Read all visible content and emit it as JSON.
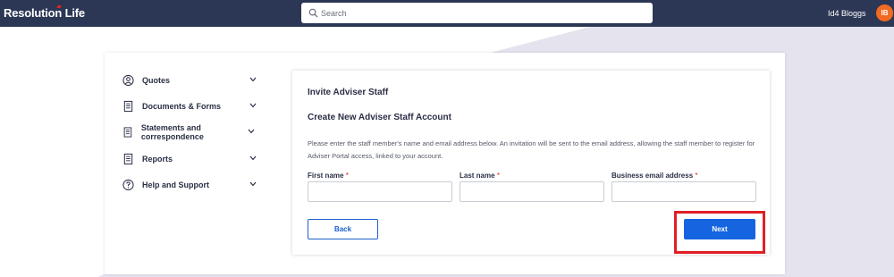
{
  "header": {
    "logo_text": "Resolution Life",
    "search_placeholder": "Search",
    "username": "Id4 Bloggs",
    "avatar_initials": "IB"
  },
  "sidebar": {
    "items": [
      {
        "label": "Quotes",
        "icon": "user-circle-icon"
      },
      {
        "label": "Documents & Forms",
        "icon": "document-icon"
      },
      {
        "label": "Statements and correspondence",
        "icon": "document-icon"
      },
      {
        "label": "Reports",
        "icon": "document-icon"
      },
      {
        "label": "Help and Support",
        "icon": "question-circle-icon"
      }
    ]
  },
  "main": {
    "title": "Invite Adviser Staff",
    "subtitle": "Create New Adviser Staff Account",
    "description": "Please enter the staff member's name and email address below. An invitation will be sent to the email address, allowing the staff member to register for Adviser Portal access, linked to your account.",
    "fields": [
      {
        "label": "First name",
        "required_mark": "*",
        "value": ""
      },
      {
        "label": "Last name",
        "required_mark": "*",
        "value": ""
      },
      {
        "label": "Business email address",
        "required_mark": "*",
        "value": ""
      }
    ],
    "back_label": "Back",
    "next_label": "Next"
  },
  "colors": {
    "header_bg": "#2c3755",
    "accent_blue": "#1565e0",
    "avatar_orange": "#f26a21",
    "highlight_red": "#e01f26",
    "bg_shape": "#e4e3ee"
  }
}
